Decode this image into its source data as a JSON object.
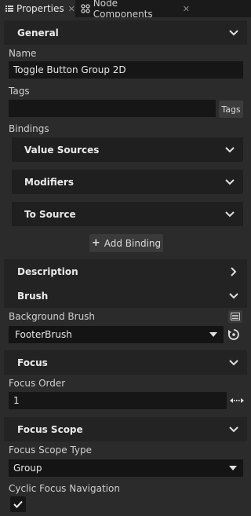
{
  "tabs": [
    {
      "label": "Properties",
      "icon": "properties-icon",
      "active": true
    },
    {
      "label": "Node Components",
      "icon": "node-components-icon",
      "active": false
    }
  ],
  "general": {
    "title": "General",
    "name_label": "Name",
    "name_value": "Toggle Button Group 2D",
    "tags_label": "Tags",
    "tags_value": "",
    "tags_button": "Tags",
    "bindings_label": "Bindings",
    "bindings": [
      {
        "label": "Value Sources"
      },
      {
        "label": "Modifiers"
      },
      {
        "label": "To Source"
      }
    ],
    "add_binding": "Add Binding"
  },
  "description": {
    "title": "Description"
  },
  "brush": {
    "title": "Brush",
    "background_brush_label": "Background Brush",
    "background_brush_value": "FooterBrush"
  },
  "focus": {
    "title": "Focus",
    "focus_order_label": "Focus Order",
    "focus_order_value": "1"
  },
  "focus_scope": {
    "title": "Focus Scope",
    "type_label": "Focus Scope Type",
    "type_value": "Group",
    "cyclic_label": "Cyclic Focus Navigation",
    "cyclic_checked": true
  },
  "colors": {
    "panel_bg": "#2b2b2b",
    "header_bg": "#232323",
    "field_bg": "#161616",
    "text": "#d4d4d4"
  }
}
